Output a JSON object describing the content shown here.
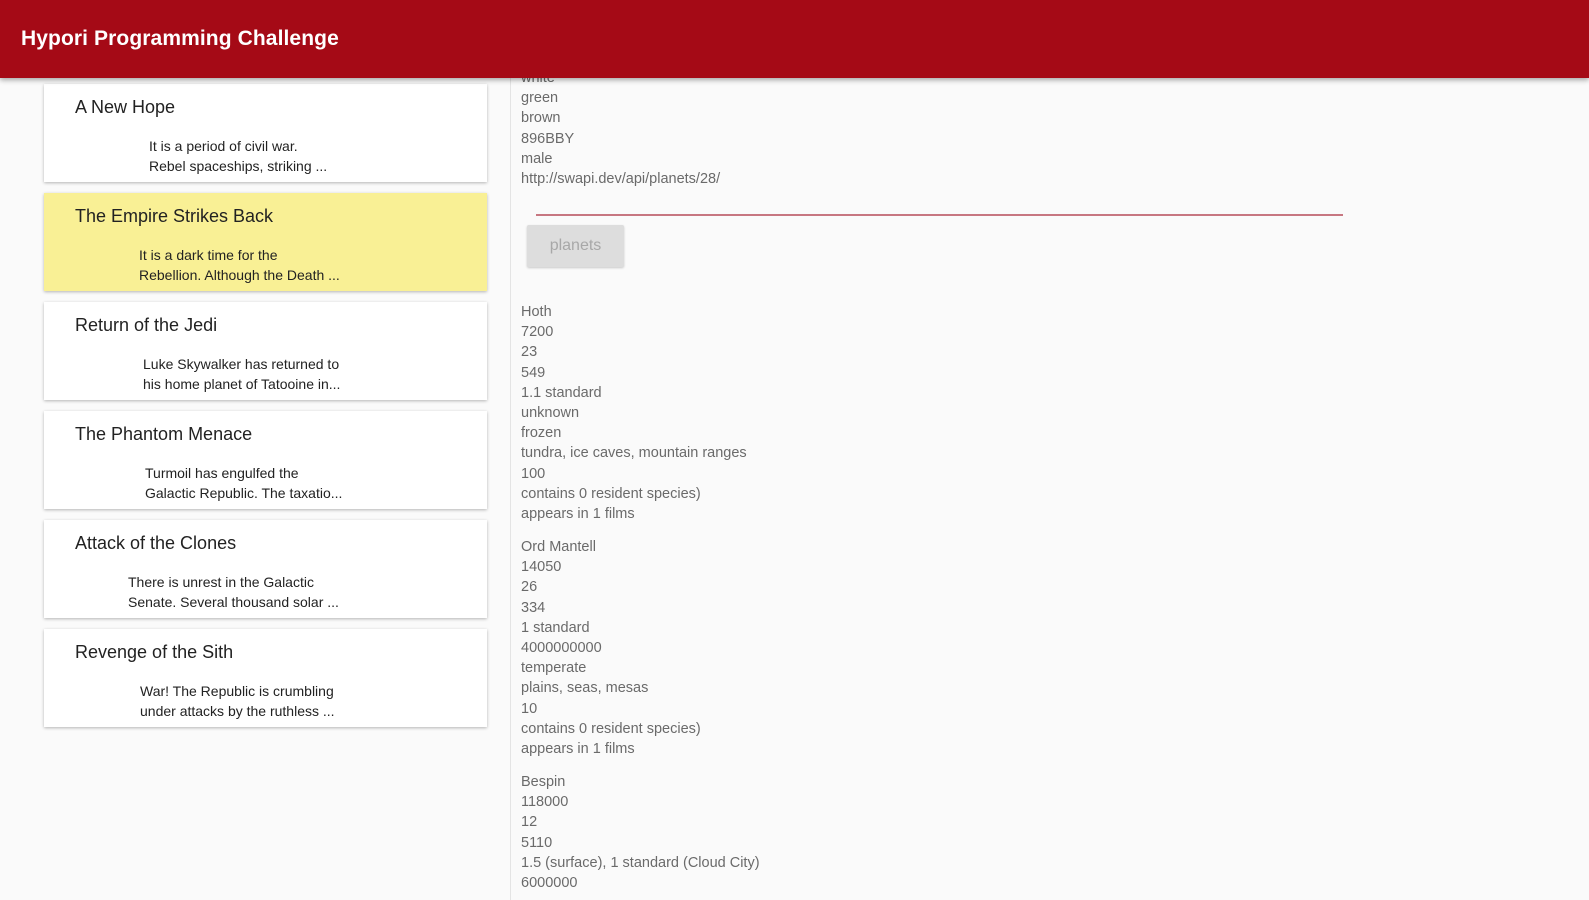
{
  "app": {
    "title": "Hypori Programming Challenge"
  },
  "films": [
    {
      "title": "A New Hope",
      "crawl_line1": "It is a period of civil war.",
      "crawl_line2": "Rebel spaceships, striking ...",
      "selected": false
    },
    {
      "title": "The Empire Strikes Back",
      "crawl_line1": "It is a dark time for the",
      "crawl_line2": "Rebellion. Although the Death ...",
      "selected": true
    },
    {
      "title": "Return of the Jedi",
      "crawl_line1": "Luke Skywalker has returned to",
      "crawl_line2": "his home planet of Tatooine in...",
      "selected": false
    },
    {
      "title": "The Phantom Menace",
      "crawl_line1": "Turmoil has engulfed the",
      "crawl_line2": "Galactic Republic. The taxatio...",
      "selected": false
    },
    {
      "title": "Attack of the Clones",
      "crawl_line1": "There is unrest in the Galactic",
      "crawl_line2": "Senate. Several thousand solar ...",
      "selected": false
    },
    {
      "title": "Revenge of the Sith",
      "crawl_line1": "War! The Republic is crumbling",
      "crawl_line2": "under attacks by the ruthless ...",
      "selected": false
    }
  ],
  "character": {
    "skin_color": "white",
    "eye_color": "green",
    "hair_color": "brown",
    "birth_year": "896BBY",
    "gender": "male",
    "homeworld": "http://swapi.dev/api/planets/28/"
  },
  "planets_button": {
    "label": "planets"
  },
  "planets": [
    {
      "name": "Hoth",
      "rotation_period": "7200",
      "orbital_period": "23",
      "diameter": "549",
      "gravity": "1.1 standard",
      "population": "unknown",
      "climate": "frozen",
      "terrain": "tundra, ice caves, mountain ranges",
      "surface_water": "100",
      "species": "contains 0 resident species)",
      "films": "appears in 1 films"
    },
    {
      "name": "Ord Mantell",
      "rotation_period": "14050",
      "orbital_period": "26",
      "diameter": "334",
      "gravity": "1 standard",
      "population": "4000000000",
      "climate": "temperate",
      "terrain": "plains, seas, mesas",
      "surface_water": "10",
      "species": "contains 0 resident species)",
      "films": "appears in 1 films"
    },
    {
      "name": "Bespin",
      "rotation_period": "118000",
      "orbital_period": "12",
      "diameter": "5110",
      "gravity": "1.5 (surface), 1 standard (Cloud City)",
      "population": "6000000"
    }
  ]
}
